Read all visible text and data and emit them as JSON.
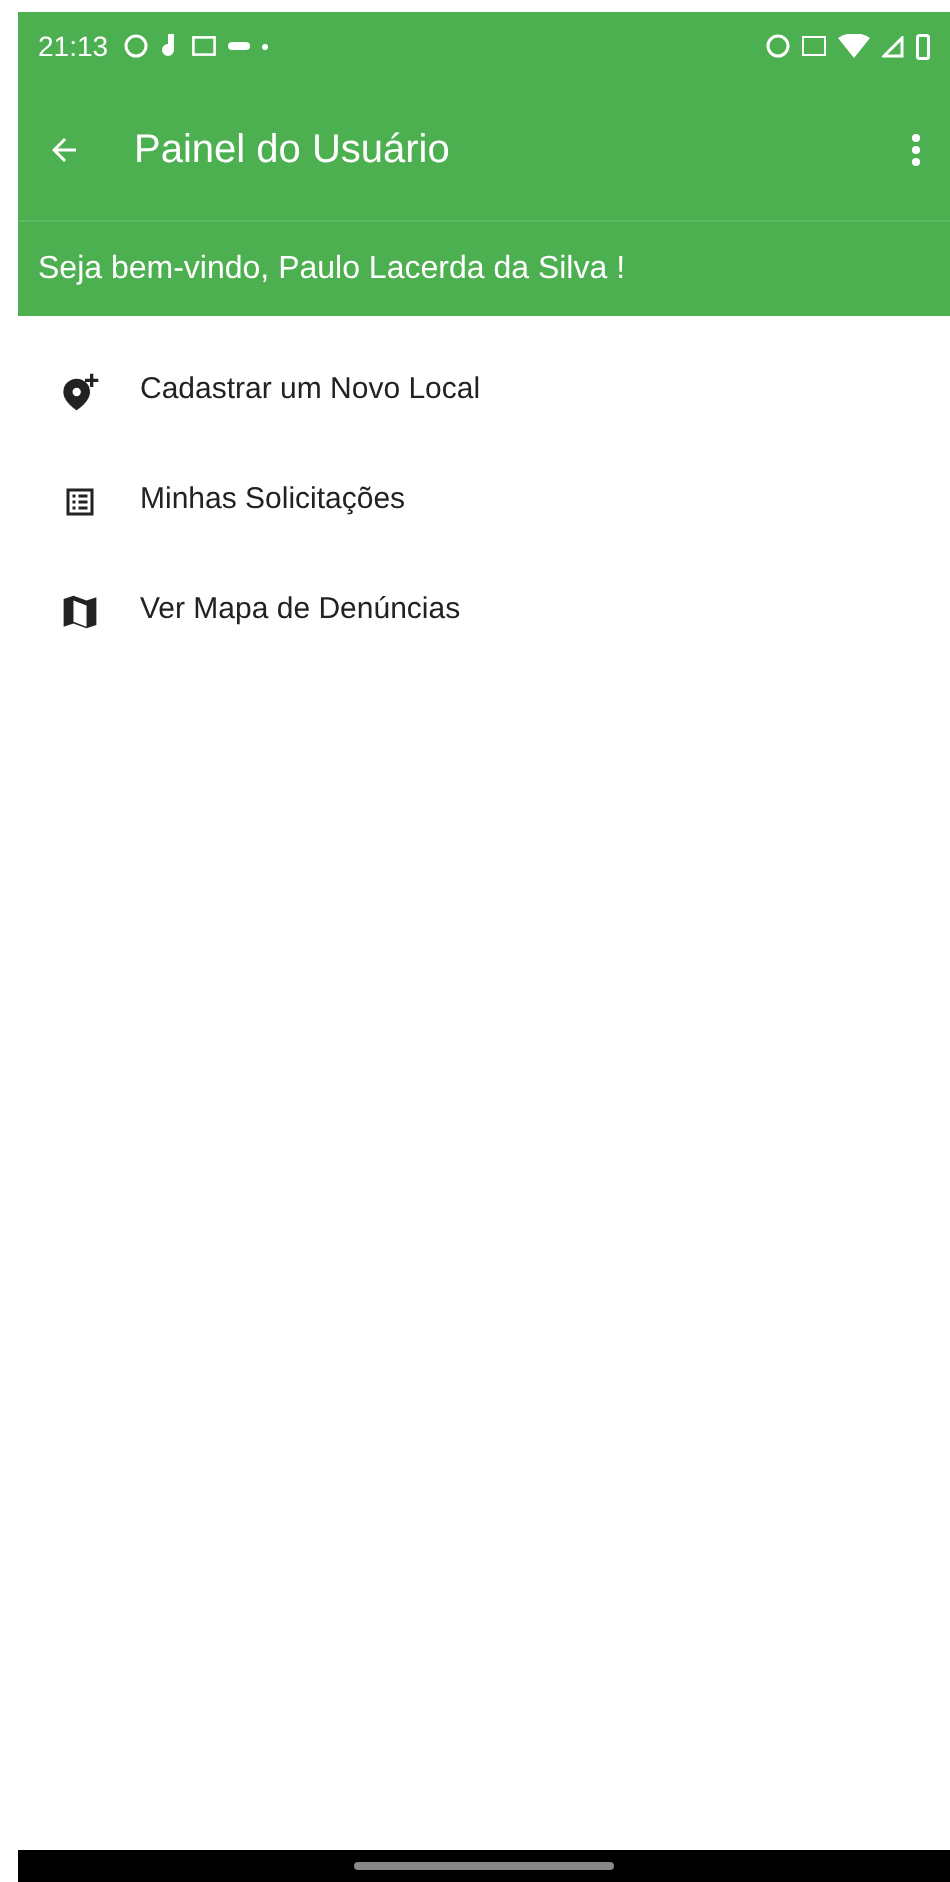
{
  "status_bar": {
    "time": "21:13"
  },
  "app_bar": {
    "title": "Painel do Usuário"
  },
  "welcome": "Seja bem-vindo, Paulo Lacerda da Silva !",
  "menu_items": [
    {
      "kind": "add-place",
      "label": "Cadastrar um Novo Local"
    },
    {
      "kind": "list",
      "label": "Minhas Solicitações"
    },
    {
      "kind": "map",
      "label": "Ver Mapa de Denúncias"
    }
  ]
}
